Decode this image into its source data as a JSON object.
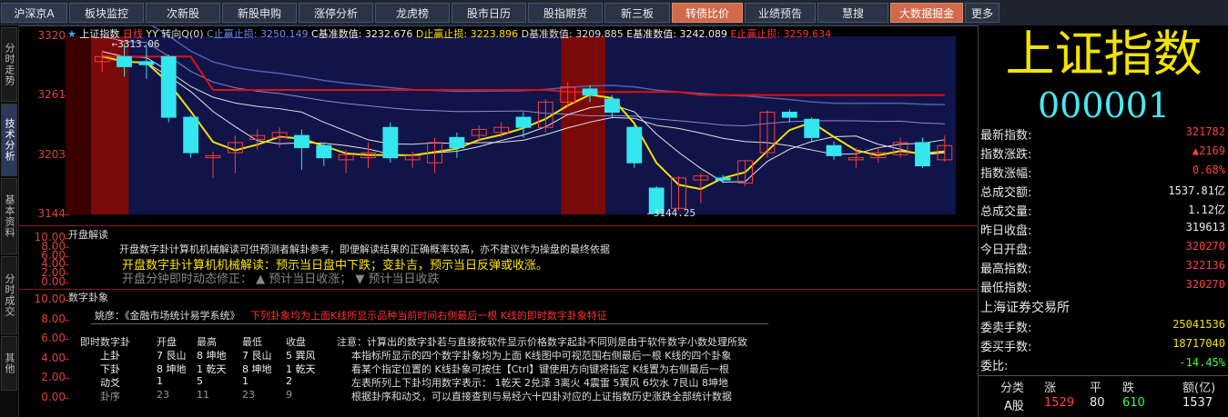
{
  "tabs": [
    {
      "label": "沪深京A",
      "w": 73
    },
    {
      "label": "板块监控",
      "w": 82
    },
    {
      "label": "次新股",
      "w": 82
    },
    {
      "label": "新股申购",
      "w": 82
    },
    {
      "label": "涨停分析",
      "w": 82
    },
    {
      "label": "龙虎榜",
      "w": 82
    },
    {
      "label": "股市日历",
      "w": 82
    },
    {
      "label": "股指期货",
      "w": 82
    },
    {
      "label": "新三板",
      "w": 72
    },
    {
      "label": "转债比价",
      "w": 78,
      "orange": true
    },
    {
      "label": "业绩预告",
      "w": 78
    },
    {
      "label": "慧搜",
      "w": 78
    },
    {
      "label": "大数据掘金",
      "w": 80,
      "orange": true
    },
    {
      "label": "更多",
      "w": 38
    }
  ],
  "left_tabs": [
    "分时走势",
    "技术分析",
    "基本资料",
    "分时成交",
    "其他"
  ],
  "chart": {
    "legend": {
      "star": "★",
      "name": "上证指数",
      "period": "日线",
      "extra": "YY 转向Q(0)",
      "c_label": "C",
      "c_text": "止赢止损:",
      "c_val": "3250.149",
      "cb_label": "C",
      "cb_text": "基准数值:",
      "cb_val": "3232.676",
      "d_label": "D",
      "d_text": "止赢止损:",
      "d_val": "3223.896",
      "db_label": "D",
      "db_text": "基准数值:",
      "db_val": "3209.885",
      "e_label": "E",
      "e_text": "基准数值:",
      "e_val": "3242.089",
      "e2_label": "E",
      "e2_text": "止赢止损:",
      "e2_val": "3259.634"
    },
    "y_ticks": [
      "3320",
      "3261",
      "3203",
      "3144"
    ],
    "high_mark": "3313.06",
    "low_mark": "3144.25",
    "candles": [
      {
        "o": 3295,
        "c": 3300,
        "h": 3305,
        "l": 3285,
        "up": true
      },
      {
        "o": 3300,
        "c": 3290,
        "h": 3313,
        "l": 3280,
        "up": false
      },
      {
        "o": 3295,
        "c": 3292,
        "h": 3312,
        "l": 3278,
        "up": false
      },
      {
        "o": 3300,
        "c": 3240,
        "h": 3302,
        "l": 3235,
        "up": false
      },
      {
        "o": 3240,
        "c": 3205,
        "h": 3242,
        "l": 3200,
        "up": false
      },
      {
        "o": 3200,
        "c": 3202,
        "h": 3206,
        "l": 3180,
        "up": true
      },
      {
        "o": 3205,
        "c": 3215,
        "h": 3222,
        "l": 3185,
        "up": true
      },
      {
        "o": 3218,
        "c": 3222,
        "h": 3228,
        "l": 3208,
        "up": true
      },
      {
        "o": 3220,
        "c": 3225,
        "h": 3230,
        "l": 3210,
        "up": true
      },
      {
        "o": 3222,
        "c": 3210,
        "h": 3228,
        "l": 3188,
        "up": false
      },
      {
        "o": 3212,
        "c": 3200,
        "h": 3215,
        "l": 3192,
        "up": false
      },
      {
        "o": 3198,
        "c": 3203,
        "h": 3208,
        "l": 3185,
        "up": true
      },
      {
        "o": 3200,
        "c": 3205,
        "h": 3215,
        "l": 3190,
        "up": true
      },
      {
        "o": 3230,
        "c": 3200,
        "h": 3235,
        "l": 3195,
        "up": false
      },
      {
        "o": 3198,
        "c": 3202,
        "h": 3206,
        "l": 3190,
        "up": true
      },
      {
        "o": 3195,
        "c": 3215,
        "h": 3220,
        "l": 3185,
        "up": true
      },
      {
        "o": 3220,
        "c": 3210,
        "h": 3225,
        "l": 3200,
        "up": false
      },
      {
        "o": 3222,
        "c": 3228,
        "h": 3232,
        "l": 3215,
        "up": true
      },
      {
        "o": 3225,
        "c": 3230,
        "h": 3235,
        "l": 3220,
        "up": true
      },
      {
        "o": 3240,
        "c": 3230,
        "h": 3245,
        "l": 3220,
        "up": false
      },
      {
        "o": 3230,
        "c": 3255,
        "h": 3258,
        "l": 3225,
        "up": true
      },
      {
        "o": 3255,
        "c": 3270,
        "h": 3275,
        "l": 3250,
        "up": true
      },
      {
        "o": 3268,
        "c": 3262,
        "h": 3272,
        "l": 3255,
        "up": false
      },
      {
        "o": 3258,
        "c": 3245,
        "h": 3262,
        "l": 3240,
        "up": false
      },
      {
        "o": 3230,
        "c": 3195,
        "h": 3232,
        "l": 3190,
        "up": false
      },
      {
        "o": 3170,
        "c": 3145,
        "h": 3172,
        "l": 3144,
        "up": false
      },
      {
        "o": 3150,
        "c": 3180,
        "h": 3182,
        "l": 3148,
        "up": true
      },
      {
        "o": 3178,
        "c": 3182,
        "h": 3185,
        "l": 3155,
        "up": true
      },
      {
        "o": 3180,
        "c": 3178,
        "h": 3183,
        "l": 3175,
        "up": false
      },
      {
        "o": 3175,
        "c": 3197,
        "h": 3198,
        "l": 3172,
        "up": true
      },
      {
        "o": 3205,
        "c": 3245,
        "h": 3247,
        "l": 3200,
        "up": true
      },
      {
        "o": 3245,
        "c": 3240,
        "h": 3248,
        "l": 3235,
        "up": false
      },
      {
        "o": 3238,
        "c": 3220,
        "h": 3240,
        "l": 3215,
        "up": false
      },
      {
        "o": 3212,
        "c": 3202,
        "h": 3216,
        "l": 3198,
        "up": false
      },
      {
        "o": 3198,
        "c": 3200,
        "h": 3210,
        "l": 3190,
        "up": true
      },
      {
        "o": 3200,
        "c": 3205,
        "h": 3210,
        "l": 3195,
        "up": true
      },
      {
        "o": 3203,
        "c": 3215,
        "h": 3220,
        "l": 3200,
        "up": true
      },
      {
        "o": 3215,
        "c": 3192,
        "h": 3220,
        "l": 3190,
        "up": false
      },
      {
        "o": 3198,
        "c": 3212,
        "h": 3222,
        "l": 3196,
        "up": true
      }
    ]
  },
  "panel1": {
    "y_ticks": [
      "10.00",
      "8.00",
      "6.00",
      "4.00",
      "2.00",
      "0.00"
    ],
    "title": "开盘解读",
    "line1": "开盘数字卦计算机机械解读可供预测者解卦参考，即便解读结果的正确概率较高，亦不建议作为操盘的最终依据",
    "line2": "开盘数字卦计算机机械解读：预示当日盘中下跌；变卦吉，预示当日反弹或收涨。",
    "line3": "开盘分钟即时动态修正：  ▲  预计当日收涨；  ▼  预计当日收跌"
  },
  "panel2": {
    "y_ticks": [
      "10.00",
      "8.00",
      "6.00",
      "4.00",
      "2.00",
      "0.00"
    ],
    "title": "数字卦象",
    "source_label": "姚彦：《金融市场统计易学系统》",
    "source_red": "下列卦象均为上面K线所显示品种当前时间右侧最后一根 K线的即时数字卦象特征",
    "table_header": [
      "即时数字卦",
      "开盘",
      "最高",
      "最低",
      "收盘"
    ],
    "rows": [
      [
        "上卦",
        "7 艮山",
        "8 坤地",
        "7 艮山",
        "5 巽风"
      ],
      [
        "下卦",
        "8 坤地",
        "1 乾天",
        "8 坤地",
        "1 乾天"
      ],
      [
        "动爻",
        "1",
        "5",
        "1",
        "2"
      ],
      [
        "卦序",
        "23",
        "11",
        "23",
        "9"
      ]
    ],
    "notes": [
      "注意：计算出的数字卦若与直接按软件显示价格数字起卦不同则是由于软件数字小数处理所致",
      "本指标所显示的四个数字卦象均为上面 K线图中可视范围右侧最后一根 K线的四个卦象",
      "看某个指定位置的 K线卦象可按住【Ctrl】键使用方向键将指定 K线置为右侧最后一根",
      "左表所列上下卦均用数字表示： 1乾天 2兑泽 3离火 4震雷 5巽风 6坎水 7艮山 8坤地",
      "根据卦序和动爻，可以直接查到与易经六十四卦对应的上证指数历史涨跌全部统计数据"
    ]
  },
  "right": {
    "title": "上证指数",
    "code": "000001",
    "rows": [
      {
        "label": "最新指数:",
        "value": "321782"
      },
      {
        "label": "指数涨跌:",
        "value": "▲2169"
      },
      {
        "label": "指数涨幅:",
        "value": "0.68%"
      },
      {
        "label": "总成交额:",
        "value": "1537.81亿",
        "white": true
      },
      {
        "label": "总成交量:",
        "value": "1.12亿",
        "white": true
      },
      {
        "label": "昨日收盘:",
        "value": "319613",
        "white": true
      },
      {
        "label": "今日开盘:",
        "value": "320270"
      },
      {
        "label": "最高指数:",
        "value": "322136"
      },
      {
        "label": "最低指数:",
        "value": "320270"
      }
    ],
    "exchange": "上海证券交易所",
    "rows2": [
      {
        "label": "委卖手数:",
        "value": "25041536",
        "yellow": true
      },
      {
        "label": "委买手数:",
        "value": "18717040",
        "yellow": true
      },
      {
        "label": "委比:",
        "value": "-14.45%",
        "green": true
      }
    ],
    "table_header": [
      "分类",
      "涨",
      "平",
      "跌",
      "额(亿)"
    ],
    "table_row": [
      "A股",
      "1529",
      "80",
      "610",
      "1537"
    ]
  },
  "colors": {
    "up": "#ff3b3b",
    "down": "#33e6f0",
    "bg": "#101448",
    "ma_yellow": "#f2e200",
    "ma_red": "#e01010"
  }
}
